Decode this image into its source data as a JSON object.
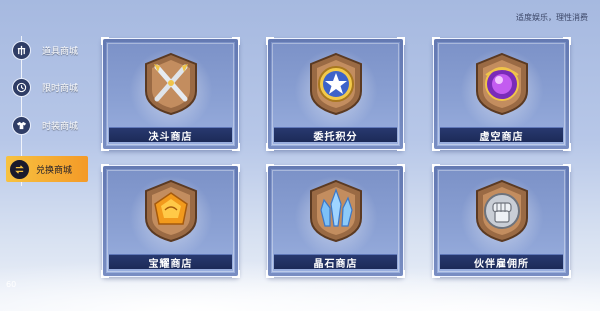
{
  "top_note": "适度娱乐，理性消费",
  "fps": "60",
  "sidebar": {
    "items": [
      {
        "label": "道具商城",
        "icon": "item-shop-icon",
        "active": false
      },
      {
        "label": "限时商城",
        "icon": "clock-icon",
        "active": false
      },
      {
        "label": "时装商城",
        "icon": "fashion-icon",
        "active": false
      },
      {
        "label": "兑换商城",
        "icon": "exchange-icon",
        "active": true
      }
    ]
  },
  "shops": [
    {
      "label": "决斗商店",
      "icon": "crossed-swords-icon"
    },
    {
      "label": "委托积分",
      "icon": "star-medal-icon"
    },
    {
      "label": "虚空商店",
      "icon": "void-orb-icon"
    },
    {
      "label": "宝耀商店",
      "icon": "amber-gem-icon"
    },
    {
      "label": "晶石商店",
      "icon": "crystal-icon"
    },
    {
      "label": "伙伴雇佣所",
      "icon": "fist-icon"
    }
  ],
  "colors": {
    "active_tab": "#f7c241",
    "banner": "#1c2a58",
    "card": "#8aa0d3"
  }
}
